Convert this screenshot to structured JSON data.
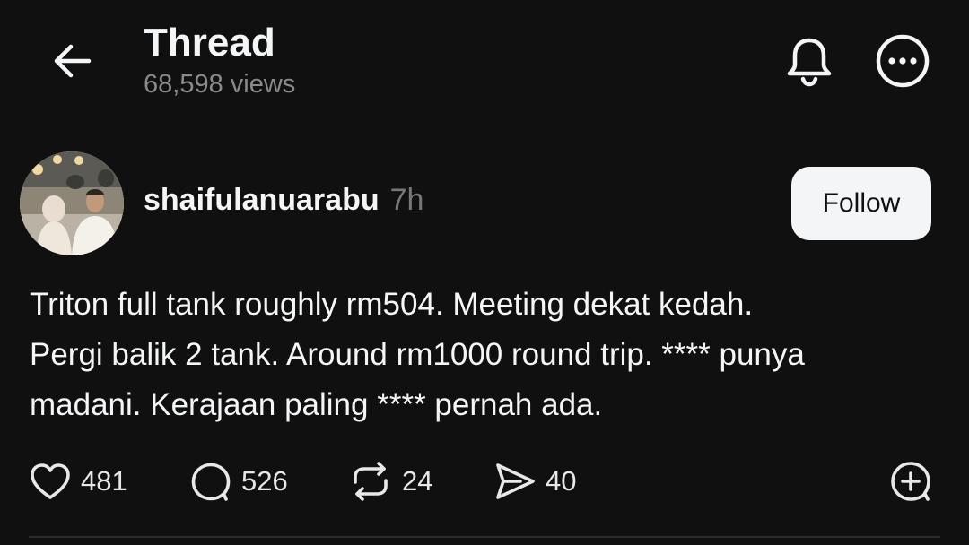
{
  "header": {
    "title": "Thread",
    "views": "68,598 views",
    "back_icon": "arrow-left-icon",
    "notify_icon": "bell-icon",
    "more_icon": "ellipsis-circle-icon"
  },
  "post": {
    "author": "shaifulanuarabu",
    "time": "7h",
    "follow_label": "Follow",
    "text_lines": [
      "Triton full tank roughly rm504. Meeting dekat kedah.",
      "Pergi balik 2 tank. Around rm1000 round trip. **** punya",
      "madani. Kerajaan paling **** pernah ada."
    ],
    "actions": {
      "likes": "481",
      "replies": "526",
      "reposts": "24",
      "shares": "40"
    }
  },
  "colors": {
    "background": "#101010",
    "text": "#f3f5f7",
    "muted": "#777777",
    "button_bg": "#f3f5f7"
  }
}
